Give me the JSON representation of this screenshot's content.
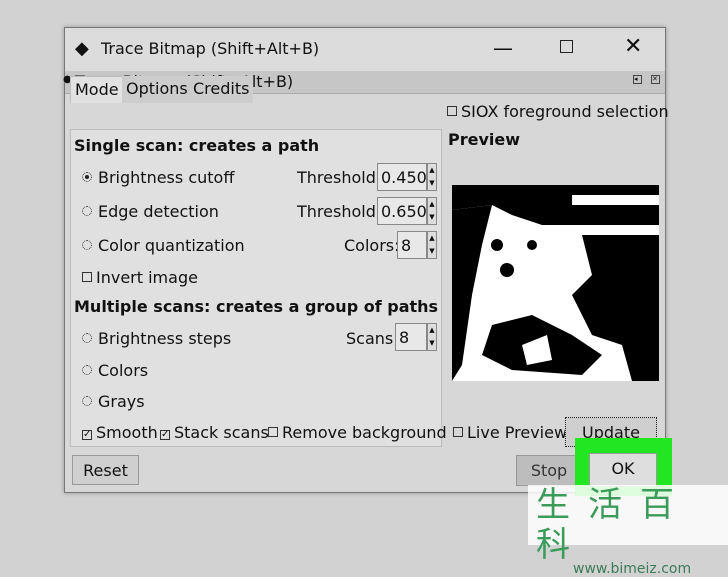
{
  "window": {
    "title": "Trace Bitmap (Shift+Alt+B)",
    "controls": [
      "minimize",
      "maximize",
      "close"
    ]
  },
  "dock": {
    "title": "Trace Bitmap (Shift+Alt+B)"
  },
  "tabs": [
    {
      "label": "Mode",
      "active": true
    },
    {
      "label": "Options"
    },
    {
      "label": "Credits"
    }
  ],
  "single": {
    "heading": "Single scan: creates a path",
    "brightness": {
      "label": "Brightness cutoff",
      "selected": true,
      "param": "Threshold:",
      "value": "0.450"
    },
    "edge": {
      "label": "Edge detection",
      "param": "Threshold:",
      "value": "0.650"
    },
    "color": {
      "label": "Color quantization",
      "param": "Colors:",
      "value": "8"
    },
    "invert": {
      "label": "Invert image",
      "checked": false
    }
  },
  "multiple": {
    "heading": "Multiple scans: creates a group of paths",
    "steps": {
      "label": "Brightness steps",
      "param": "Scans:",
      "value": "8"
    },
    "colors": {
      "label": "Colors"
    },
    "grays": {
      "label": "Grays"
    },
    "smooth": {
      "label": "Smooth",
      "checked": true
    },
    "stack": {
      "label": "Stack scans",
      "checked": true
    },
    "remove_bg": {
      "label": "Remove background",
      "checked": false
    }
  },
  "siox": {
    "label": "SIOX foreground selection",
    "checked": false
  },
  "preview": {
    "heading": "Preview",
    "live_label": "Live Preview",
    "live_checked": false,
    "update_label": "Update"
  },
  "buttons": {
    "reset": "Reset",
    "stop": "Stop",
    "ok": "OK"
  },
  "highlight_color": "#22e622",
  "watermark": {
    "text": "生活百科",
    "url": "www.bimeiz.com"
  }
}
